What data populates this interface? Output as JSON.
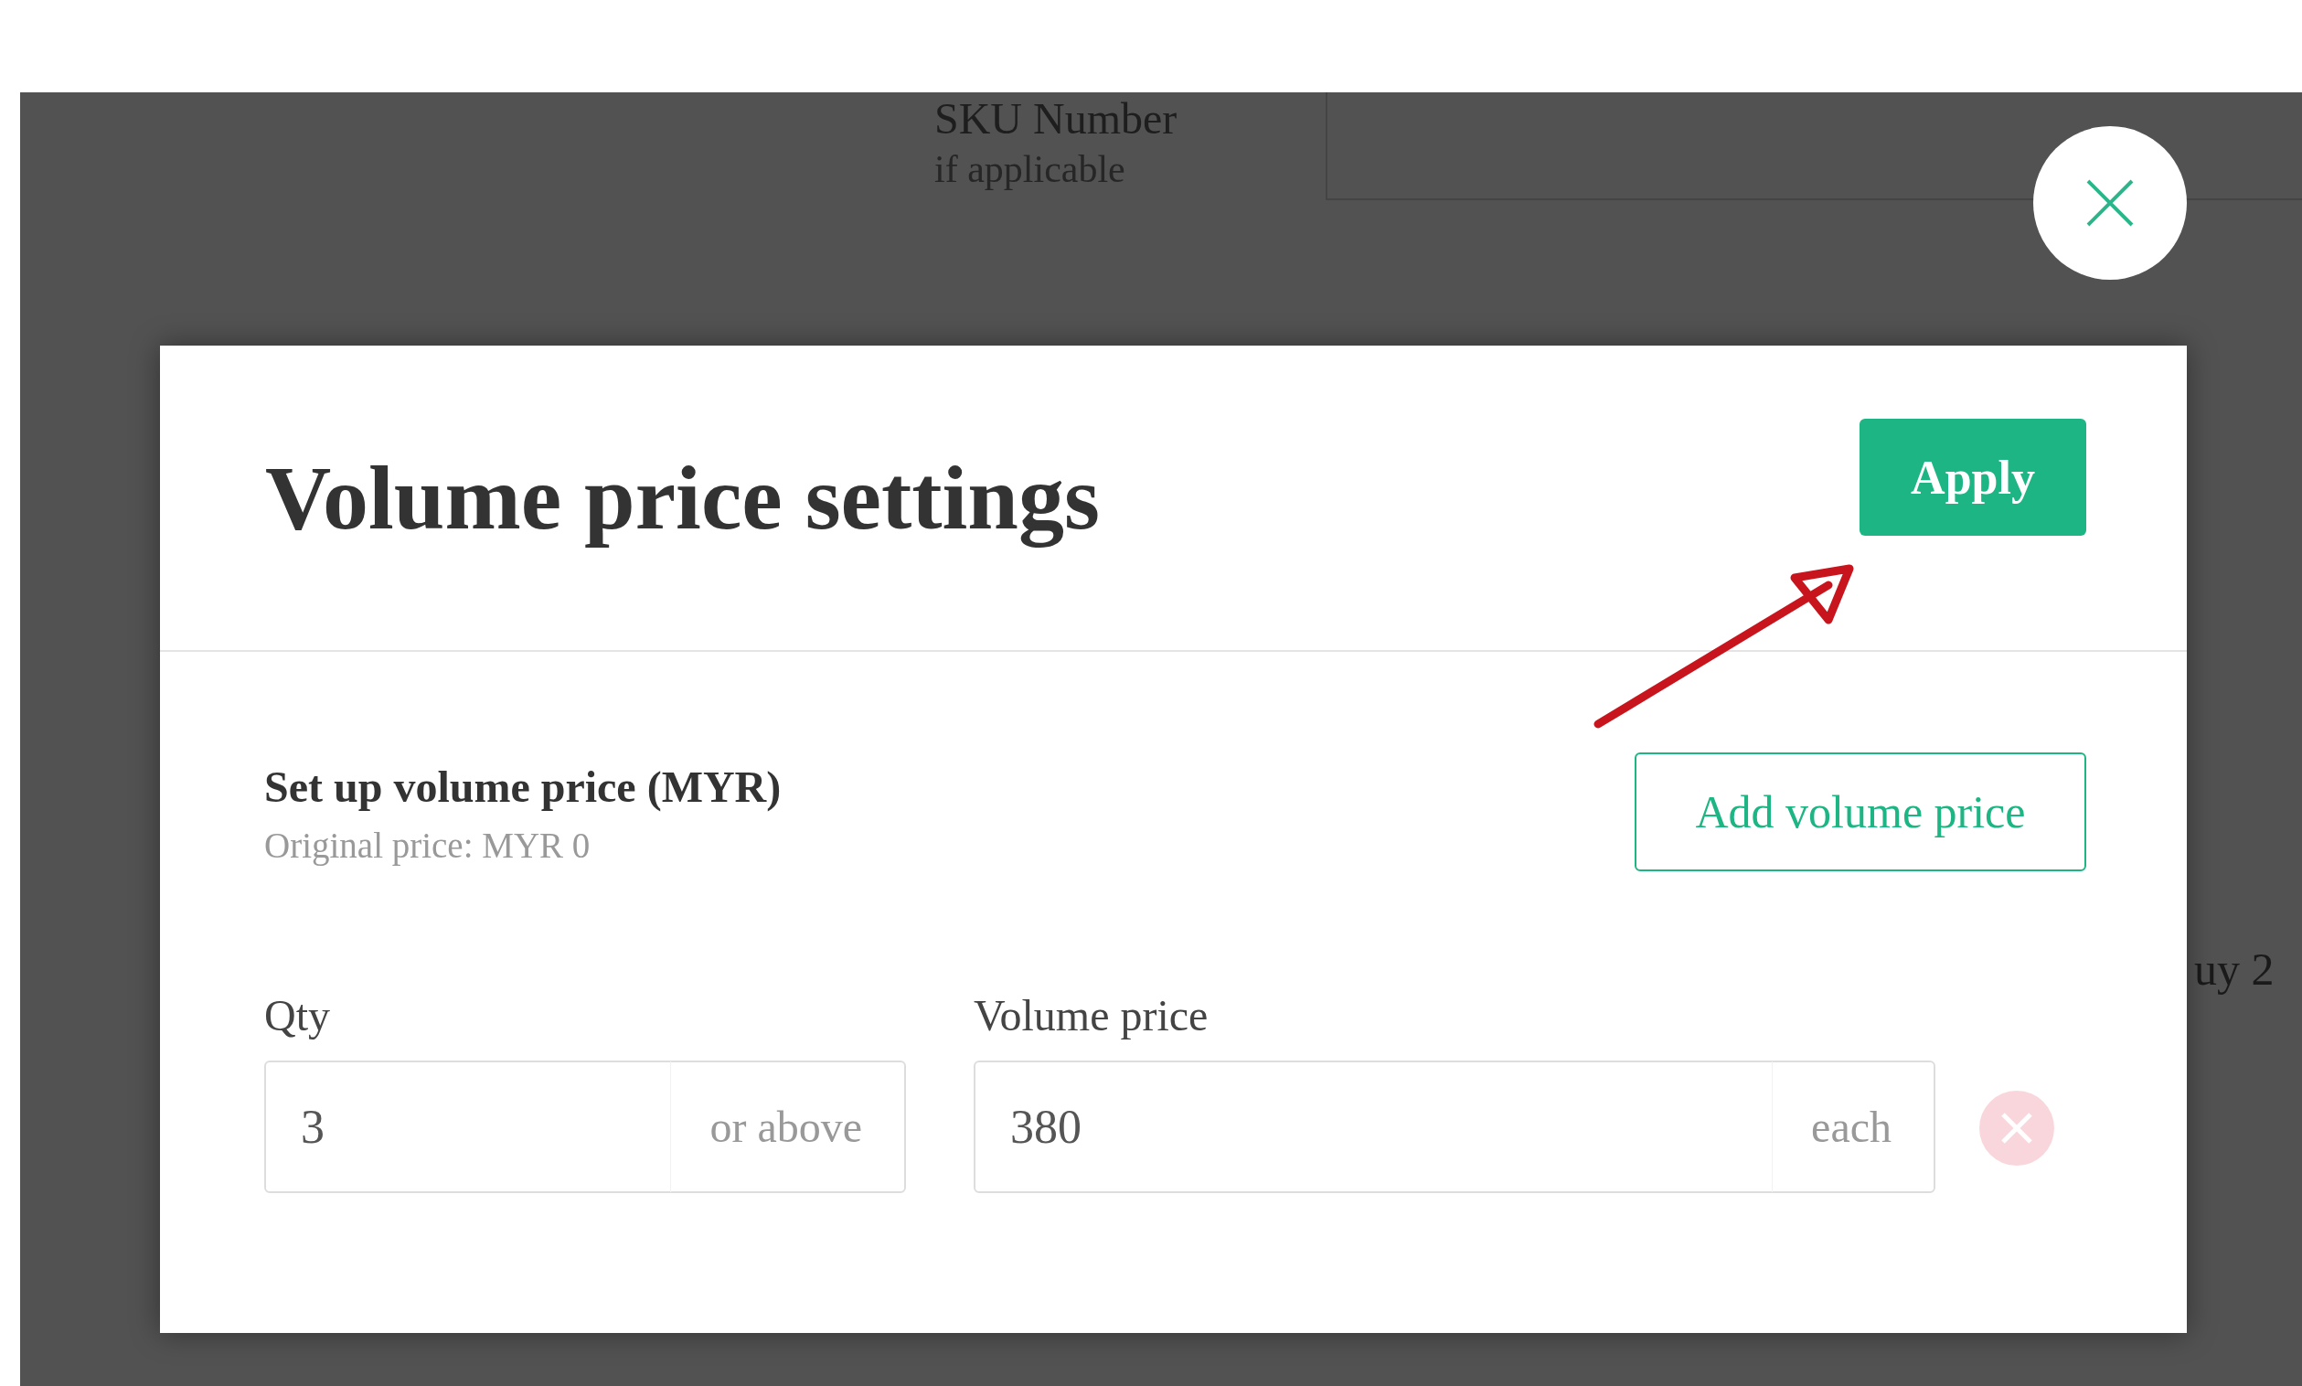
{
  "background": {
    "sku_label": "SKU Number",
    "sku_hint": "if applicable",
    "side_text": "uy 2"
  },
  "modal": {
    "title": "Volume price settings",
    "apply_button": "Apply",
    "section_title": "Set up volume price (MYR)",
    "section_note": "Original price: MYR 0",
    "add_button": "Add volume price",
    "rows": [
      {
        "qty_label": "Qty",
        "qty_value": "3",
        "qty_suffix": "or above",
        "price_label": "Volume price",
        "price_value": "380",
        "price_suffix": "each",
        "remove_disabled": true
      }
    ]
  }
}
